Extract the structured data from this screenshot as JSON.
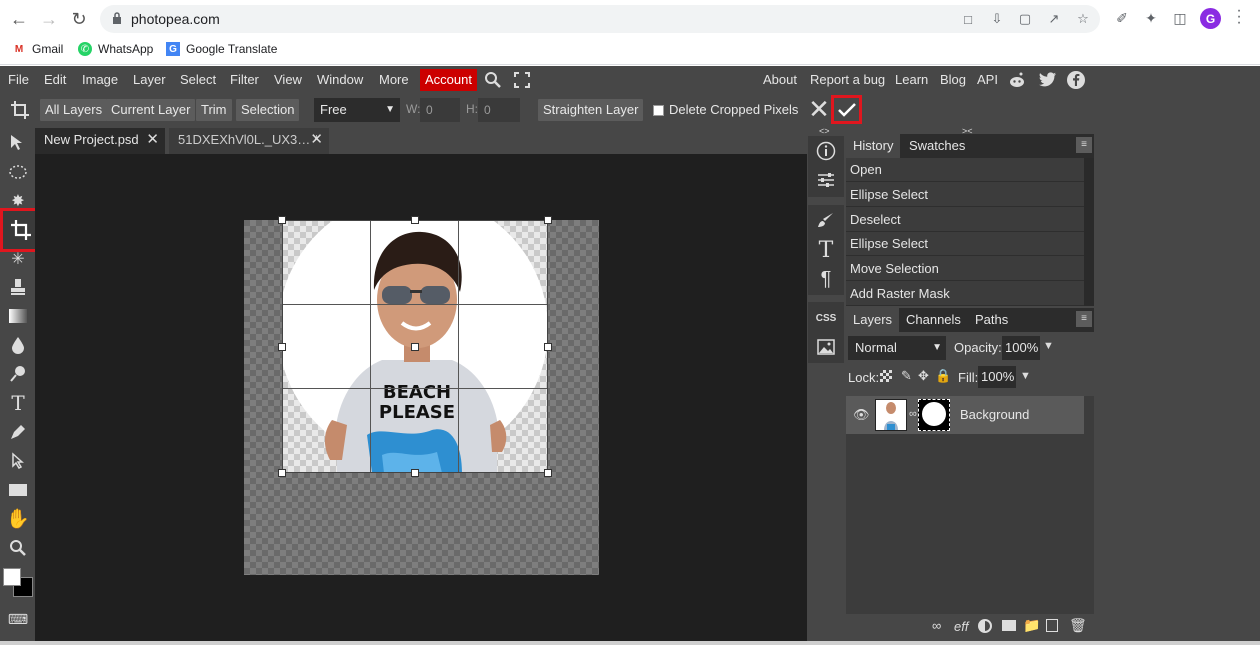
{
  "browser": {
    "url": "photopea.com",
    "bookmarks": [
      {
        "label": "Gmail",
        "icon": "gmail-icon",
        "color": "#d93025"
      },
      {
        "label": "WhatsApp",
        "icon": "whatsapp-icon",
        "color": "#25d366"
      },
      {
        "label": "Google Translate",
        "icon": "translate-icon",
        "color": "#4285f4"
      }
    ],
    "profile_initial": "G"
  },
  "menu": {
    "items": [
      "File",
      "Edit",
      "Image",
      "Layer",
      "Select",
      "Filter",
      "View",
      "Window",
      "More"
    ],
    "account": "Account",
    "right": [
      "About",
      "Report a bug",
      "Learn",
      "Blog",
      "API"
    ]
  },
  "options": {
    "all_layers": "All Layers",
    "current_layer": "Current Layer",
    "trim": "Trim",
    "selection": "Selection",
    "ratio": "Free",
    "w_label": "W:",
    "w_value": "0",
    "h_label": "H:",
    "h_value": "0",
    "straighten": "Straighten Layer",
    "delete_cropped": "Delete Cropped Pixels"
  },
  "tabs": [
    {
      "label": "New Project.psd"
    },
    {
      "label": "51DXEXhVl0L._UX3… *"
    }
  ],
  "history": {
    "tabs": [
      "History",
      "Swatches"
    ],
    "items": [
      "Open",
      "Ellipse Select",
      "Deselect",
      "Ellipse Select",
      "Move Selection",
      "Add Raster Mask"
    ]
  },
  "layers": {
    "tabs": [
      "Layers",
      "Channels",
      "Paths"
    ],
    "blend_mode": "Normal",
    "opacity_label": "Opacity:",
    "opacity_value": "100%",
    "lock_label": "Lock:",
    "fill_label": "Fill:",
    "fill_value": "100%",
    "items": [
      {
        "name": "Background"
      }
    ],
    "bottom_eff": "eff"
  },
  "canvas": {
    "shirt_text_line1": "BEACH",
    "shirt_text_line2": "PLEASE"
  },
  "panel_icons": {
    "css_label": "CSS"
  },
  "colors": {
    "accent_red": "#e0161e",
    "account_bg": "#cc0000",
    "app_bg": "#474747",
    "canvas_bg": "#1f1f1f"
  }
}
